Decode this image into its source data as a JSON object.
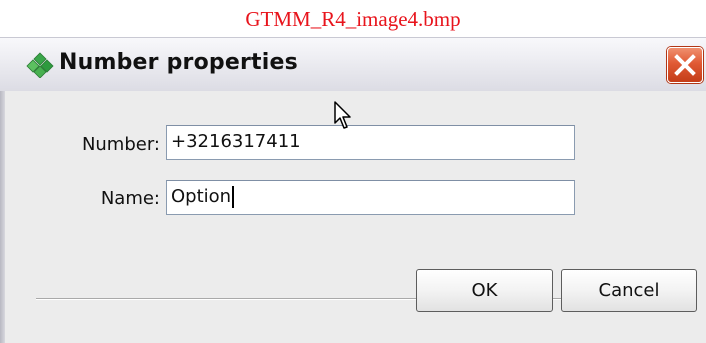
{
  "caption": "GTMM_R4_image4.bmp",
  "window": {
    "title": "Number properties",
    "icon": "green-diamond-icon",
    "close_icon": "close-icon"
  },
  "form": {
    "number_label": "Number:",
    "number_value": "+3216317411",
    "name_label": "Name:",
    "name_value": "Option"
  },
  "buttons": {
    "ok_label": "OK",
    "cancel_label": "Cancel"
  },
  "colors": {
    "caption": "#e8141c",
    "close_button": "#d9532c",
    "title_icon": "#3aa64a"
  }
}
